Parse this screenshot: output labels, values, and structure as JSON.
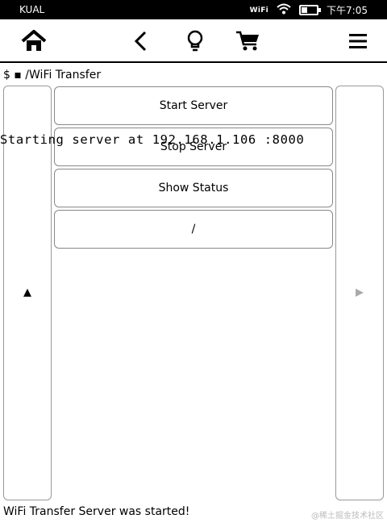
{
  "status_bar": {
    "app_name": "KUAL",
    "wifi_label": "WiFi",
    "battery_level": 0.4,
    "time": "下午7:05"
  },
  "toolbar": {
    "icons": [
      "home-icon",
      "back-icon",
      "lightbulb-icon",
      "cart-icon",
      "menu-icon"
    ]
  },
  "breadcrumb": {
    "text": "$ ▪ /WiFi Transfer"
  },
  "buttons": {
    "start": "Start Server",
    "stop": "Stop Server",
    "status": "Show Status",
    "root": "/"
  },
  "side_panels": {
    "left_arrow": "▲",
    "right_arrow": "▶"
  },
  "terminal": {
    "line": "Starting server at 192.168.1.106 :8000"
  },
  "footer": {
    "message": "WiFi Transfer Server was started!",
    "watermark": "@稀土掘金技术社区"
  }
}
